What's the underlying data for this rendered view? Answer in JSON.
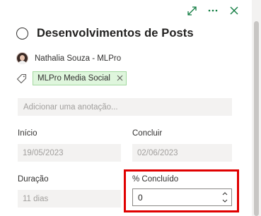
{
  "task": {
    "title": "Desenvolvimentos de Posts",
    "assignee": "Nathalia Souza - MLPro",
    "label": "MLPro Media Social",
    "note_placeholder": "Adicionar uma anotação..."
  },
  "fields": {
    "start": {
      "label": "Início",
      "value": "19/05/2023"
    },
    "end": {
      "label": "Concluir",
      "value": "02/06/2023"
    },
    "duration": {
      "label": "Duração",
      "value": "11 dias"
    },
    "percent": {
      "label": "% Concluído",
      "value": "0"
    }
  },
  "icons": {
    "expand": "expand-icon",
    "more": "more-options-icon",
    "close": "close-icon",
    "tag": "tag-icon",
    "remove": "remove-icon"
  },
  "colors": {
    "accent": "#107c41",
    "chip_bg": "#dff6dd",
    "highlight": "#e00000"
  }
}
